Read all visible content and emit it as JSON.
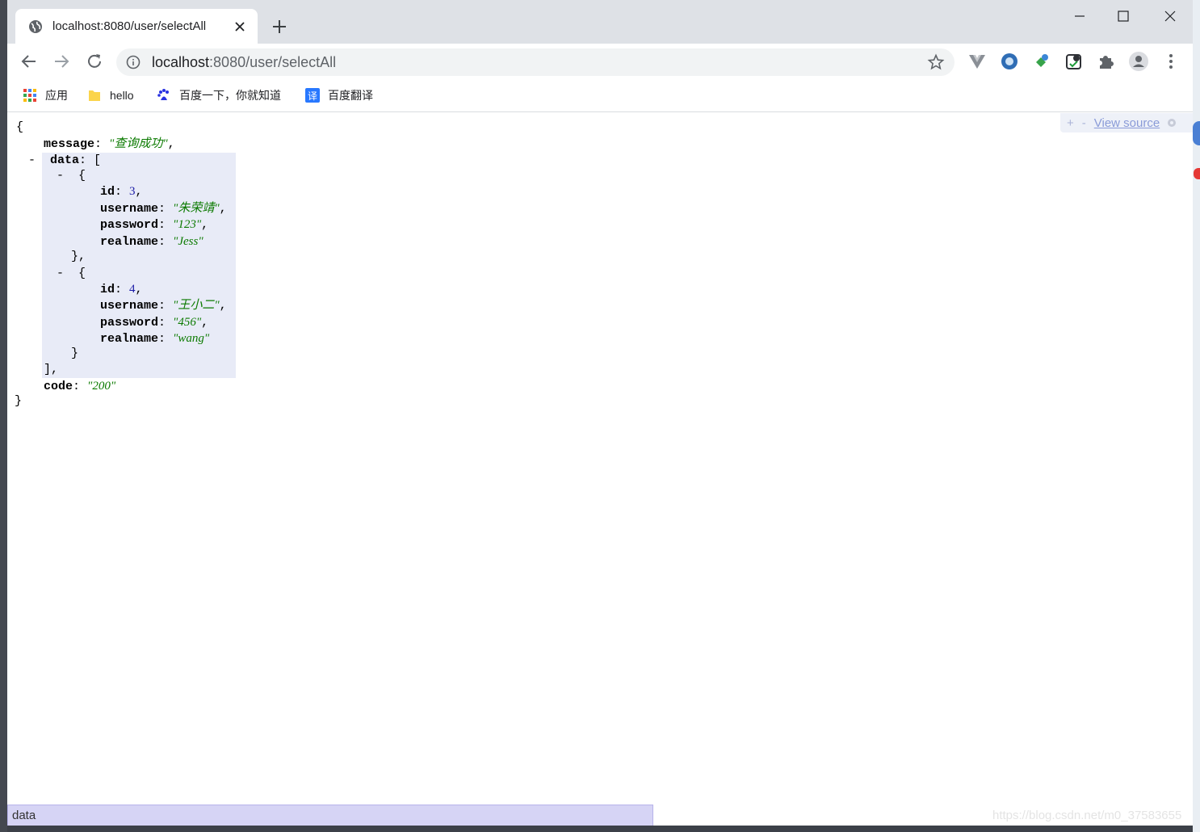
{
  "tab": {
    "title": "localhost:8080/user/selectAll"
  },
  "omnibox": {
    "host": "localhost",
    "path": ":8080/user/selectAll"
  },
  "bookmarks": [
    {
      "label": "应用",
      "icon": "apps-grid-icon"
    },
    {
      "label": "hello",
      "icon": "folder-icon"
    },
    {
      "label": "百度一下，你就知道",
      "icon": "baidu-paw-icon"
    },
    {
      "label": "百度翻译",
      "icon": "baidu-translate-icon"
    }
  ],
  "viewer": {
    "plus": "+",
    "minus": "-",
    "view_source": "View source",
    "json": {
      "message_key": "message",
      "message_val": "\"查询成功\"",
      "data_key": "data",
      "items": [
        {
          "id": "3",
          "username": "\"朱荣靖\"",
          "password": "\"123\"",
          "realname": "\"Jess\""
        },
        {
          "id": "4",
          "username": "\"王小二\"",
          "password": "\"456\"",
          "realname": "\"wang\""
        }
      ],
      "code_key": "code",
      "code_val": "\"200\""
    }
  },
  "status_text": "data",
  "watermark": "https://blog.csdn.net/m0_37583655"
}
